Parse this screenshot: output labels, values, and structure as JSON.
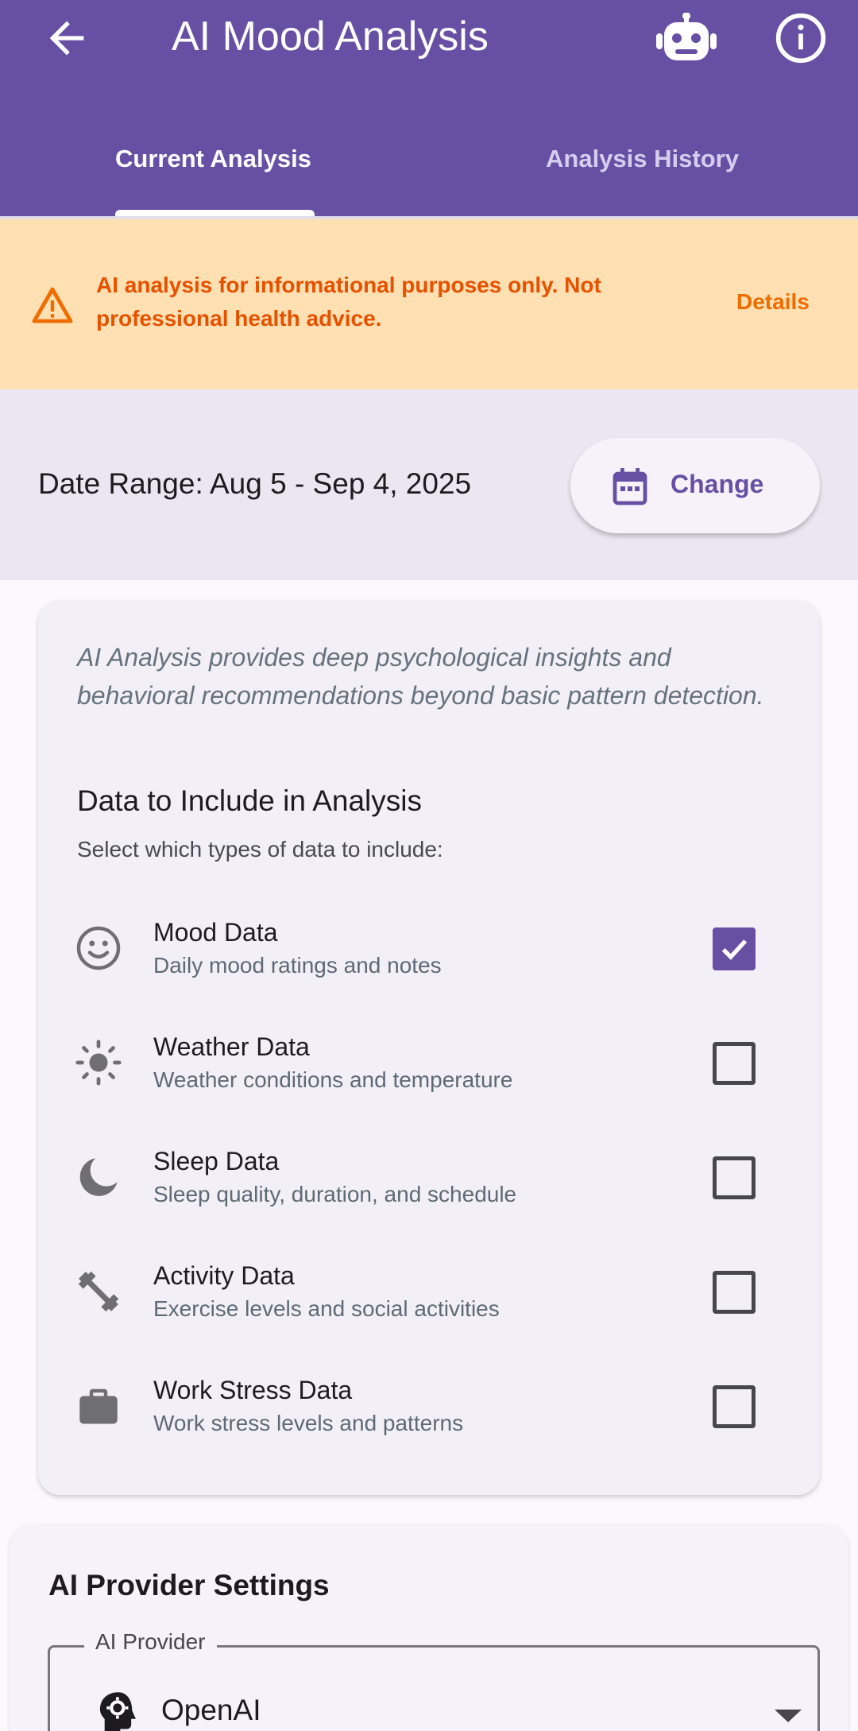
{
  "app_bar": {
    "title": "AI Mood Analysis",
    "back_icon": "arrow-back-icon",
    "robot_icon": "robot-icon",
    "info_icon": "info-icon"
  },
  "tabs": [
    {
      "label": "Current Analysis",
      "selected": true
    },
    {
      "label": "Analysis History",
      "selected": false
    }
  ],
  "disclaimer": {
    "text": "AI analysis for informational purposes only. Not professional health advice.",
    "details_label": "Details",
    "icon": "warning-icon"
  },
  "date_range": {
    "label": "Date Range: Aug 5 - Sep 4, 2025",
    "change_label": "Change",
    "icon": "calendar-icon"
  },
  "data_card": {
    "intro": "AI Analysis provides deep psychological insights and behavioral recommendations beyond basic pattern detection.",
    "heading": "Data to Include in Analysis",
    "subheading": "Select which types of data to include:",
    "items": [
      {
        "name": "Mood Data",
        "desc": "Daily mood ratings and notes",
        "icon": "smiley-face-icon",
        "checked": true
      },
      {
        "name": "Weather Data",
        "desc": "Weather conditions and temperature",
        "icon": "sun-icon",
        "checked": false
      },
      {
        "name": "Sleep Data",
        "desc": "Sleep quality, duration, and schedule",
        "icon": "moon-icon",
        "checked": false
      },
      {
        "name": "Activity Data",
        "desc": "Exercise levels and social activities",
        "icon": "dumbbell-icon",
        "checked": false
      },
      {
        "name": "Work Stress Data",
        "desc": "Work stress levels and patterns",
        "icon": "briefcase-icon",
        "checked": false
      }
    ]
  },
  "provider": {
    "heading": "AI Provider Settings",
    "field_label": "AI Provider",
    "value": "OpenAI",
    "icon": "brain-gear-icon"
  },
  "colors": {
    "primary": "#6750a4",
    "banner_bg": "#ffe0b2",
    "banner_text": "#e65100"
  }
}
